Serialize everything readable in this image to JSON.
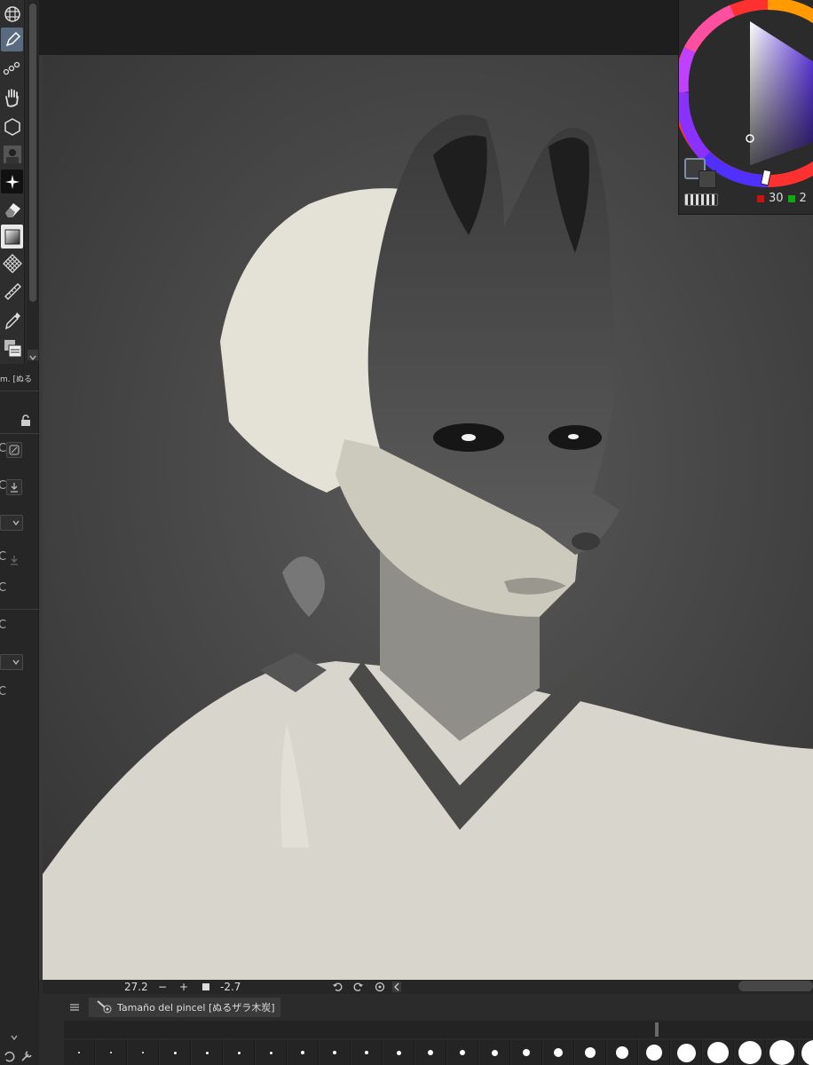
{
  "toolbar": {
    "tools": [
      {
        "name": "grid-tool-icon"
      },
      {
        "name": "pen-tool-icon",
        "active": true
      },
      {
        "name": "chain-tool-icon"
      },
      {
        "name": "hand-tool-icon"
      },
      {
        "name": "hexagon-tool-icon"
      },
      {
        "name": "thumbnail-tool-icon"
      },
      {
        "name": "sparkle-tool-icon"
      },
      {
        "name": "eraser-tool-icon"
      },
      {
        "name": "gradient-tool-icon"
      },
      {
        "name": "pattern-tool-icon"
      },
      {
        "name": "ruler-tool-icon"
      },
      {
        "name": "eyedropper-tool-icon"
      },
      {
        "name": "layer-tool-icon"
      }
    ]
  },
  "tool_property": {
    "title": "m. [ぬる"
  },
  "color_panel": {
    "red_value": "30",
    "green_value": "2",
    "red_color": "#cc1111",
    "green_color": "#11aa11"
  },
  "status": {
    "zoom": "27.2",
    "minus": "−",
    "plus": "+",
    "angle": "-2.7"
  },
  "brush_size_panel": {
    "tab_label": "Tamaño del pincel [ぬるザラ木炭]",
    "size_levels": [
      0.3,
      0.3,
      0.3,
      0.35,
      0.35,
      0.4,
      0.4,
      0.45,
      0.5,
      0.55,
      0.6,
      0.7,
      0.8,
      0.9,
      1.0,
      1.2,
      1.5,
      1.8,
      2.2,
      2.6,
      3.0,
      3.3,
      3.5,
      3.6
    ]
  }
}
